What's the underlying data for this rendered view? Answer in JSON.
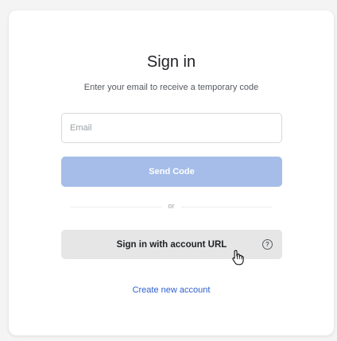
{
  "signin": {
    "title": "Sign in",
    "subtitle": "Enter your email to receive a temporary code",
    "email_placeholder": "Email",
    "email_value": "",
    "send_code_label": "Send Code",
    "divider_label": "or",
    "account_url_label": "Sign in with account URL",
    "help_icon_glyph": "?",
    "create_account_label": "Create new account"
  },
  "icons": {
    "help": "question-circle-icon",
    "cursor": "hand-pointer-icon"
  },
  "colors": {
    "primary_disabled": "#a6bde9",
    "link": "#2f5fcf",
    "secondary_button": "#e6e6e7"
  }
}
